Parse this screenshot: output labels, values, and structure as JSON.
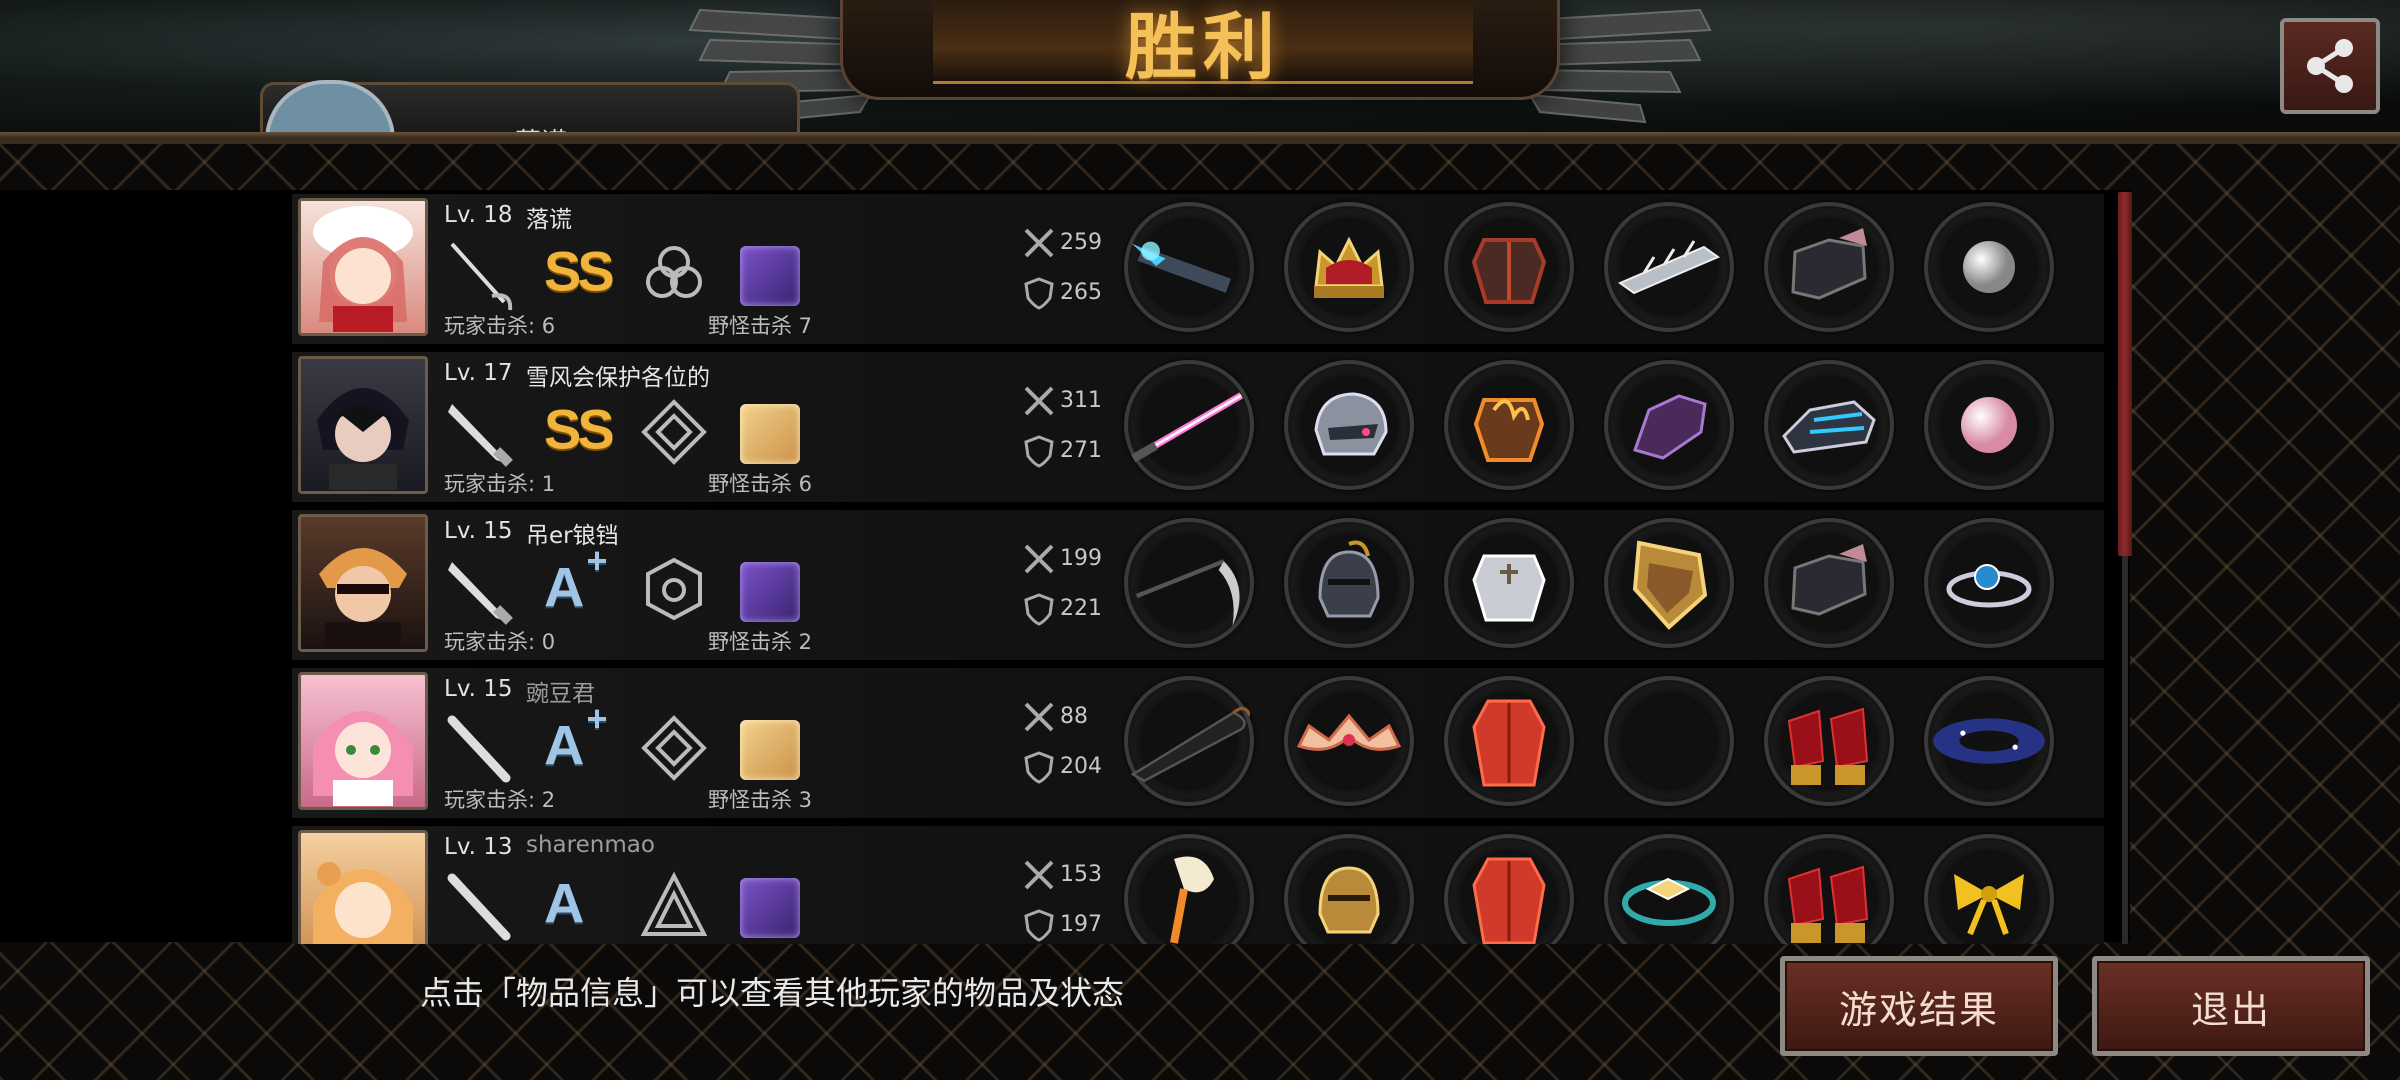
{
  "title": "胜利",
  "me_name": "落谎",
  "hint": "点击「物品信息」可以查看其他玩家的物品及状态",
  "buttons": {
    "result": "游戏结果",
    "exit": "退出"
  },
  "players": [
    {
      "level": "Lv. 18",
      "name": "落谎",
      "grade": "SS",
      "grade_plus": "",
      "player_kills": "玩家击杀: 6",
      "monster_kills": "野怪击杀 7",
      "atk": "259",
      "def": "265",
      "items": [
        "plasma-rifle",
        "royal-crown",
        "red-armor",
        "blade-bracer",
        "dark-boots",
        "pearl-orb"
      ]
    },
    {
      "level": "Lv. 17",
      "name": "雪风会保护各位的",
      "grade": "SS",
      "grade_plus": "",
      "player_kills": "玩家击杀: 1",
      "monster_kills": "野怪击杀 6",
      "atk": "311",
      "def": "271",
      "items": [
        "laser-sword",
        "cyber-helmet",
        "flame-armor",
        "shadow-gauntlet",
        "tech-boots",
        "pink-pearl"
      ]
    },
    {
      "level": "Lv. 15",
      "name": "吊er锒铛",
      "grade": "A",
      "grade_plus": "+",
      "player_kills": "玩家击杀: 0",
      "monster_kills": "野怪击杀 2",
      "atk": "199",
      "def": "221",
      "items": [
        "scythe",
        "knight-helmet",
        "plate-armor",
        "gold-shield",
        "dark-boots",
        "sapphire-ring"
      ]
    },
    {
      "level": "Lv. 15",
      "name": "豌豆君",
      "grade": "A",
      "grade_plus": "+",
      "player_kills": "玩家击杀: 2",
      "monster_kills": "野怪击杀 3",
      "atk": "88",
      "def": "204",
      "items": [
        "umbrella",
        "winged-tiara",
        "red-coat",
        "empty",
        "red-heels",
        "galaxy-orb"
      ]
    },
    {
      "level": "Lv. 13",
      "name": "sharenmao",
      "grade": "A",
      "grade_plus": "",
      "player_kills": "",
      "monster_kills": "",
      "atk": "153",
      "def": "197",
      "items": [
        "fan-torch",
        "gold-helmet",
        "red-coat",
        "crystal-bracelet",
        "red-heels",
        "gold-ribbon"
      ]
    }
  ],
  "colors": {
    "accent_gold": "#f3c157",
    "button_red": "#6b3025",
    "scroll_red": "#8c2b2b"
  }
}
